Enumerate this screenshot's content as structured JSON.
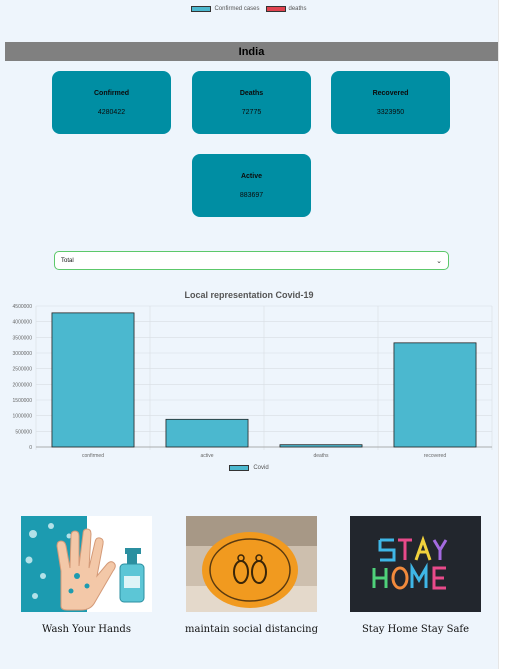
{
  "top_legend": [
    {
      "label": "Confirmed cases",
      "color": "#4bb8cf"
    },
    {
      "label": "deaths",
      "color": "#e0434f"
    }
  ],
  "country": "India",
  "stats": {
    "confirmed": {
      "label": "Confirmed",
      "value": "4280422"
    },
    "deaths": {
      "label": "Deaths",
      "value": "72775"
    },
    "recovered": {
      "label": "Recovered",
      "value": "3323950"
    },
    "active": {
      "label": "Active",
      "value": "883697"
    }
  },
  "select": {
    "value": "Total"
  },
  "chart_data": {
    "type": "bar",
    "title": "Local representation Covid-19",
    "categories": [
      "confirmed",
      "active",
      "deaths",
      "recovered"
    ],
    "series": [
      {
        "name": "Covid",
        "values": [
          4280422,
          883697,
          72775,
          3323950
        ],
        "color": "#4bb8cf"
      }
    ],
    "ylim": [
      0,
      4500000
    ],
    "yticks": [
      0,
      500000,
      1000000,
      1500000,
      2000000,
      2500000,
      3000000,
      3500000,
      4000000,
      4500000
    ],
    "grid": true,
    "legend": "bottom"
  },
  "tips": [
    {
      "caption": "Wash Your Hands",
      "icon": "hand-sanitizer-image"
    },
    {
      "caption": "maintain social distancing",
      "icon": "floor-distancing-sticker-image"
    },
    {
      "caption": "Stay Home Stay Safe",
      "icon": "stay-home-chalkboard-image"
    }
  ],
  "colors": {
    "card": "#008ea3",
    "header": "#808080",
    "page": "#eef5fc"
  }
}
